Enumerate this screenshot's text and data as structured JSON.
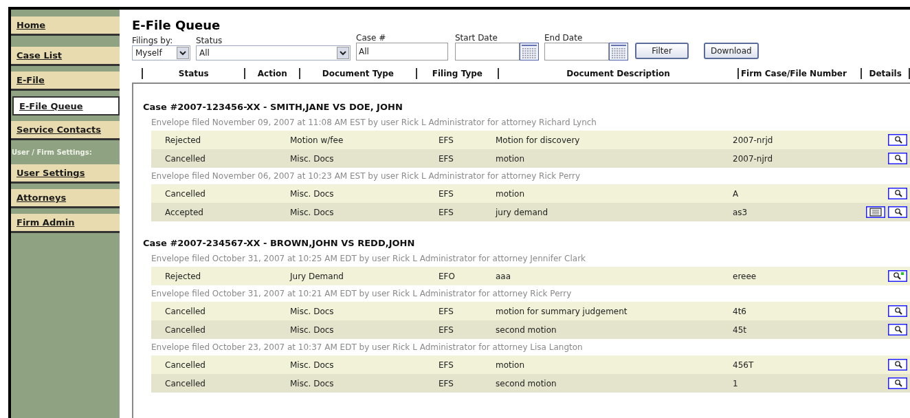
{
  "sidebar": {
    "items": [
      {
        "label": "Home",
        "selected": false
      },
      {
        "label": "Case List",
        "selected": false
      },
      {
        "label": "E-File",
        "selected": false
      },
      {
        "label": "E-File Queue",
        "selected": true
      },
      {
        "label": "Service Contacts",
        "selected": false
      },
      {
        "kind": "heading",
        "label": "User / Firm Settings:"
      },
      {
        "label": "User Settings",
        "selected": false
      },
      {
        "label": "Attorneys",
        "selected": false
      },
      {
        "label": "Firm Admin",
        "selected": false
      }
    ]
  },
  "page_title": "E-File Queue",
  "filters": {
    "filings_by": {
      "label": "Filings by:",
      "value": "Myself"
    },
    "status": {
      "label": "Status",
      "value": "All"
    },
    "case_number": {
      "label": "Case #",
      "value": "All"
    },
    "start_date": {
      "label": "Start Date"
    },
    "end_date": {
      "label": "End Date"
    },
    "buttons": [
      "Filter",
      "Download"
    ]
  },
  "columns": [
    "Status",
    "Action",
    "Document Type",
    "Filing Type",
    "Document Description",
    "Firm Case/File Number",
    "Details"
  ],
  "cases": [
    {
      "title": "Case #2007-123456-XX - SMITH,JANE VS DOE, JOHN",
      "envelopes": [
        {
          "text": "Envelope filed November 09, 2007 at 11:08 AM EST by user Rick L Administrator for attorney Richard Lynch",
          "rows": [
            {
              "status": "Rejected",
              "document_type": "Motion w/fee",
              "filing_type": "EFS",
              "description": "Motion for discovery",
              "file_number": "2007-nrjd",
              "details": [
                {
                  "kind": "view"
                }
              ]
            },
            {
              "status": "Cancelled",
              "document_type": "Misc. Docs",
              "filing_type": "EFS",
              "description": "motion",
              "file_number": "2007-njrd",
              "details": [
                {
                  "kind": "view"
                }
              ]
            }
          ]
        },
        {
          "text": "Envelope filed November 06, 2007 at 10:23 AM EST by user Rick L Administrator for attorney Rick Perry",
          "rows": [
            {
              "status": "Cancelled",
              "document_type": "Misc. Docs",
              "filing_type": "EFS",
              "description": "motion",
              "file_number": "A",
              "details": [
                {
                  "kind": "view"
                }
              ]
            },
            {
              "status": "Accepted",
              "document_type": "Misc. Docs",
              "filing_type": "EFS",
              "description": "jury demand",
              "file_number": "as3",
              "details": [
                {
                  "kind": "document"
                },
                {
                  "kind": "view"
                }
              ]
            }
          ]
        }
      ]
    },
    {
      "title": "Case #2007-234567-XX - BROWN,JOHN VS REDD,JOHN",
      "envelopes": [
        {
          "text": "Envelope filed October 31, 2007 at 10:25 AM EDT by user Rick L Administrator for attorney Jennifer Clark",
          "rows": [
            {
              "status": "Rejected",
              "document_type": "Jury Demand",
              "filing_type": "EFO",
              "description": "aaa",
              "file_number": "ereee",
              "details": [
                {
                  "kind": "view-new"
                }
              ]
            }
          ]
        },
        {
          "text": "Envelope filed October 31, 2007 at 10:21 AM EDT by user Rick L Administrator for attorney Rick Perry",
          "rows": [
            {
              "status": "Cancelled",
              "document_type": "Misc. Docs",
              "filing_type": "EFS",
              "description": "motion for summary judgement",
              "file_number": "4t6",
              "details": [
                {
                  "kind": "view"
                }
              ]
            },
            {
              "status": "Cancelled",
              "document_type": "Misc. Docs",
              "filing_type": "EFS",
              "description": "second motion",
              "file_number": "45t",
              "details": [
                {
                  "kind": "view"
                }
              ]
            }
          ]
        },
        {
          "text": "Envelope filed October 23, 2007 at 10:37 AM EDT by user Rick L Administrator for attorney Lisa Langton",
          "rows": [
            {
              "status": "Cancelled",
              "document_type": "Misc. Docs",
              "filing_type": "EFS",
              "description": "motion",
              "file_number": "456T",
              "details": [
                {
                  "kind": "view"
                }
              ]
            },
            {
              "status": "Cancelled",
              "document_type": "Misc. Docs",
              "filing_type": "EFS",
              "description": "second motion",
              "file_number": "1",
              "details": [
                {
                  "kind": "view"
                }
              ]
            }
          ]
        }
      ]
    }
  ]
}
